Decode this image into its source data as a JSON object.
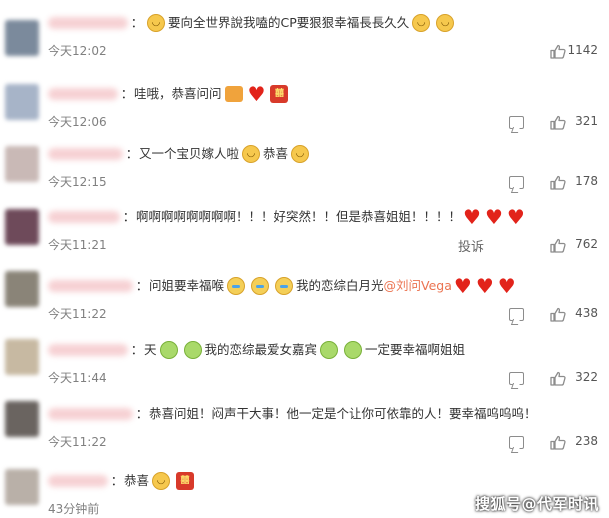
{
  "comments": [
    {
      "text": "要向全世界說我嗑的CP要狠狠幸福長長久久",
      "time": "今天12:02",
      "likes": "1142",
      "avatar_color": "#7b8a9c",
      "emoji_before": [
        "face"
      ],
      "emoji_after": [
        "face",
        "face"
      ]
    },
    {
      "text": "哇哦，恭喜问问",
      "time": "今天12:06",
      "likes": "321",
      "avatar_color": "#a7b4c8",
      "emoji_after": [
        "pack",
        "heart",
        "red"
      ]
    },
    {
      "text": "又一个宝贝嫁人啦",
      "time": "今天12:15",
      "likes": "178",
      "avatar_color": "#c9b9b6",
      "text2": "恭喜",
      "emoji_after": [
        "face"
      ],
      "emoji_after2": [
        "face"
      ]
    },
    {
      "text": "啊啊啊啊啊啊啊啊！！！好突然！！但是恭喜姐姐！！！！",
      "time": "今天11:21",
      "likes": "762",
      "avatar_color": "#6e4a5a",
      "report_label": "投诉",
      "emoji_after": [
        "heart",
        "heart",
        "heart"
      ]
    },
    {
      "text": "问姐要幸福喉",
      "time": "今天11:22",
      "likes": "438",
      "avatar_color": "#8a8478",
      "text2": "我的恋综白月光",
      "mention": "@刘问Vega",
      "emoji_after": [
        "cry",
        "cry",
        "cry"
      ],
      "emoji_end": [
        "heart",
        "heart",
        "heart"
      ]
    },
    {
      "text": "天",
      "time": "今天11:44",
      "likes": "322",
      "avatar_color": "#c7b9a2",
      "text2": "我的恋综最爱女嘉宾",
      "text3": "一定要幸福啊姐姐",
      "emoji_after": [
        "green",
        "green"
      ],
      "emoji_after2": [
        "green",
        "green"
      ]
    },
    {
      "text": "恭喜问姐！闷声干大事！他一定是个让你可依靠的人！要幸福呜呜呜！",
      "time": "今天11:22",
      "likes": "238",
      "avatar_color": "#6a6460"
    },
    {
      "text": "恭喜",
      "time": "43分钟前",
      "avatar_color": "#b9b0a8",
      "emoji_after": [
        "face",
        "red"
      ]
    }
  ],
  "watermark": "搜狐号@代军时讯",
  "colors": {
    "like_icon": "#8c8c8c",
    "heart": "#e2231a",
    "mention": "#eb7350",
    "time": "#808080"
  },
  "icons": {
    "reply": "comment-icon",
    "like": "thumbs-up-icon"
  }
}
